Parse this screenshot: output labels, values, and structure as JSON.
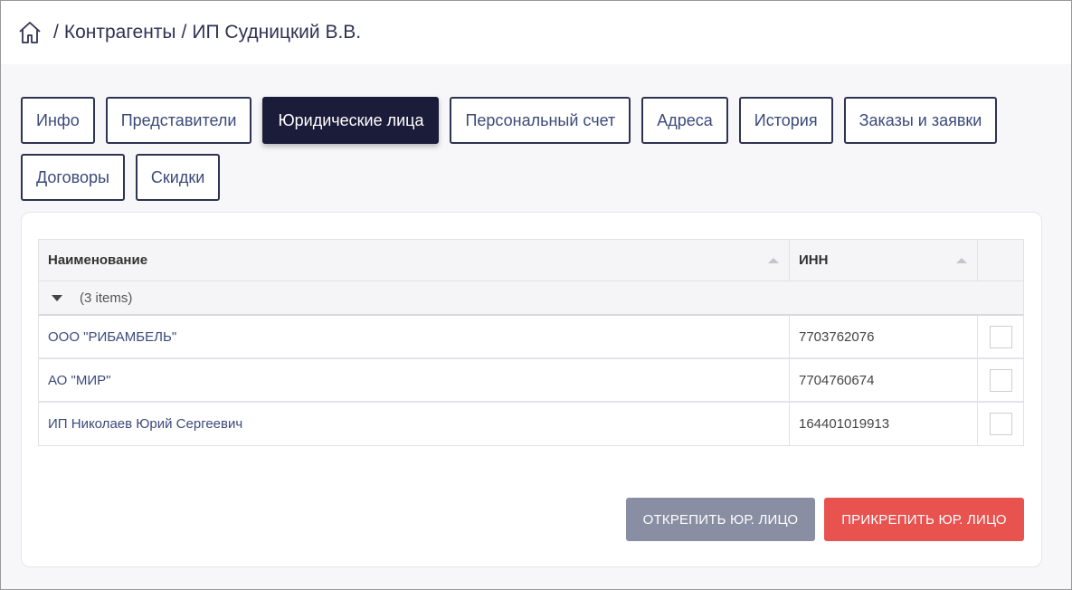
{
  "breadcrumb": {
    "home_icon": "home-icon",
    "separator": "/",
    "items": [
      "Контрагенты",
      "ИП Судницкий В.В."
    ]
  },
  "tabs": [
    {
      "label": "Инфо",
      "active": false
    },
    {
      "label": "Представители",
      "active": false
    },
    {
      "label": "Юридические лица",
      "active": true
    },
    {
      "label": "Персональный счет",
      "active": false
    },
    {
      "label": "Адреса",
      "active": false
    },
    {
      "label": "История",
      "active": false
    },
    {
      "label": "Заказы и заявки",
      "active": false
    },
    {
      "label": "Договоры",
      "active": false
    },
    {
      "label": "Скидки",
      "active": false
    }
  ],
  "grid": {
    "columns": {
      "name": "Наименование",
      "inn": "ИНН"
    },
    "group_label": "(3 items)",
    "rows": [
      {
        "name": "ООО \"РИБАМБЕЛЬ\"",
        "inn": "7703762076",
        "checked": false
      },
      {
        "name": "АО \"МИР\"",
        "inn": "7704760674",
        "checked": false
      },
      {
        "name": "ИП Николаев Юрий Сергеевич",
        "inn": "164401019913",
        "checked": false
      }
    ]
  },
  "buttons": {
    "detach_label": "ОТКРЕПИТЬ ЮР. ЛИЦО",
    "attach_label": "ПРИКРЕПИТЬ ЮР. ЛИЦО"
  },
  "colors": {
    "active_tab": "#1b1c3a",
    "detach_button": "#8a8ea3",
    "attach_button": "#e8524f",
    "link_text": "#3b4a7a"
  }
}
